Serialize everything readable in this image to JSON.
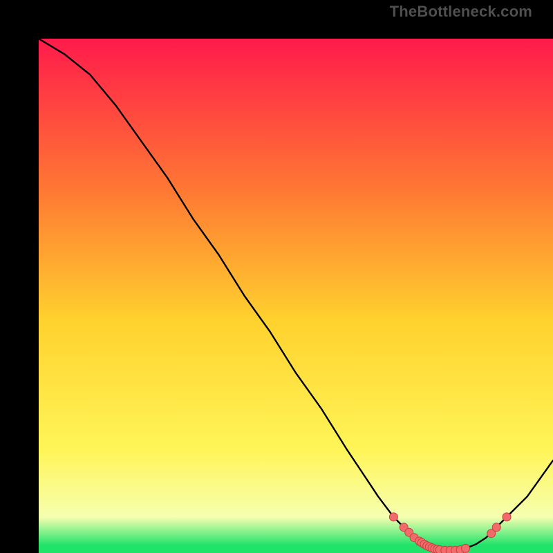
{
  "watermark": "TheBottleneck.com",
  "colors": {
    "bg": "#000000",
    "grad_top": "#ff1b4b",
    "grad_mid_upper": "#ff7a33",
    "grad_mid": "#ffd22e",
    "grad_mid_lower": "#fff558",
    "grad_pale": "#f6ffb0",
    "grad_green": "#21e36a",
    "curve": "#000000",
    "marker_fill": "#f26a6a",
    "marker_stroke": "#c24242"
  },
  "chart_data": {
    "type": "line",
    "title": "",
    "xlabel": "",
    "ylabel": "",
    "xlim": [
      0,
      100
    ],
    "ylim": [
      0,
      100
    ],
    "series": [
      {
        "name": "bottleneck-curve",
        "x": [
          0,
          5,
          10,
          15,
          20,
          25,
          30,
          35,
          40,
          45,
          50,
          55,
          60,
          62,
          64,
          66,
          69,
          70,
          71,
          72,
          73,
          74,
          75,
          76,
          77,
          78,
          79,
          80,
          81,
          82,
          83,
          85,
          87,
          89,
          91,
          95,
          100
        ],
        "y": [
          100,
          97,
          93,
          87,
          80,
          73,
          65,
          58,
          50,
          43,
          35,
          28,
          20,
          17,
          14,
          11,
          7,
          6,
          5,
          4,
          3,
          2.3,
          1.7,
          1.2,
          0.8,
          0.6,
          0.5,
          0.5,
          0.5,
          0.6,
          0.9,
          1.7,
          3,
          5,
          7,
          11,
          18
        ]
      }
    ],
    "markers": {
      "name": "optimal-range",
      "x": [
        69,
        71,
        72,
        73,
        74,
        74.5,
        75,
        75.5,
        76,
        76.5,
        77,
        77.5,
        78,
        79,
        80,
        81,
        82,
        83,
        88,
        89,
        91
      ],
      "y": [
        7,
        5,
        4,
        3,
        2.3,
        2.0,
        1.7,
        1.4,
        1.2,
        1.0,
        0.8,
        0.7,
        0.6,
        0.5,
        0.5,
        0.5,
        0.6,
        0.9,
        3.8,
        5,
        7
      ]
    }
  }
}
